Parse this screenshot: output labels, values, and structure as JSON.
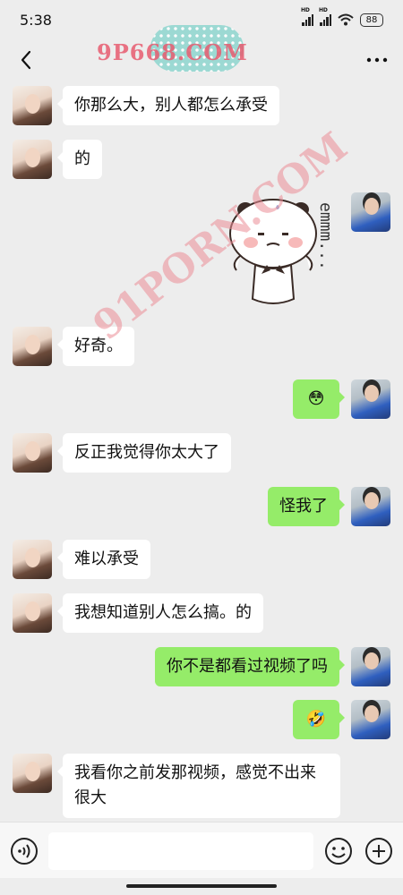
{
  "status_bar": {
    "time": "5:38",
    "signal_label_1": "HD",
    "signal_label_2": "HD",
    "battery": "88"
  },
  "nav": {
    "back_icon": "chevron-left-icon",
    "more_icon": "more-dots-icon"
  },
  "watermarks": {
    "top": "9P668.COM",
    "diagonal": "91PORN.COM"
  },
  "messages": [
    {
      "sender": "her",
      "type": "text",
      "text": "你那么大，别人都怎么承受"
    },
    {
      "sender": "her",
      "type": "text",
      "text": "的"
    },
    {
      "sender": "me",
      "type": "sticker",
      "sticker": "panda-bear-sweating-sticker",
      "text": "emmm..."
    },
    {
      "sender": "her",
      "type": "text",
      "text": "好奇。"
    },
    {
      "sender": "me",
      "type": "emoji",
      "emoji": "😳"
    },
    {
      "sender": "her",
      "type": "text",
      "text": "反正我觉得你太大了"
    },
    {
      "sender": "me",
      "type": "text",
      "text": "怪我了"
    },
    {
      "sender": "her",
      "type": "text",
      "text": "难以承受"
    },
    {
      "sender": "her",
      "type": "text",
      "text": "我想知道别人怎么搞。的"
    },
    {
      "sender": "me",
      "type": "text",
      "text": "你不是都看过视频了吗"
    },
    {
      "sender": "me",
      "type": "emoji",
      "emoji": "🤣"
    },
    {
      "sender": "her",
      "type": "text",
      "text": "我看你之前发那视频，感觉不出来很大"
    }
  ],
  "input_bar": {
    "voice_icon": "voice-icon",
    "emoji_icon": "emoji-icon",
    "add_icon": "plus-icon",
    "value": ""
  },
  "colors": {
    "background": "#ededed",
    "incoming_bubble": "#ffffff",
    "outgoing_bubble": "#95ec69"
  }
}
